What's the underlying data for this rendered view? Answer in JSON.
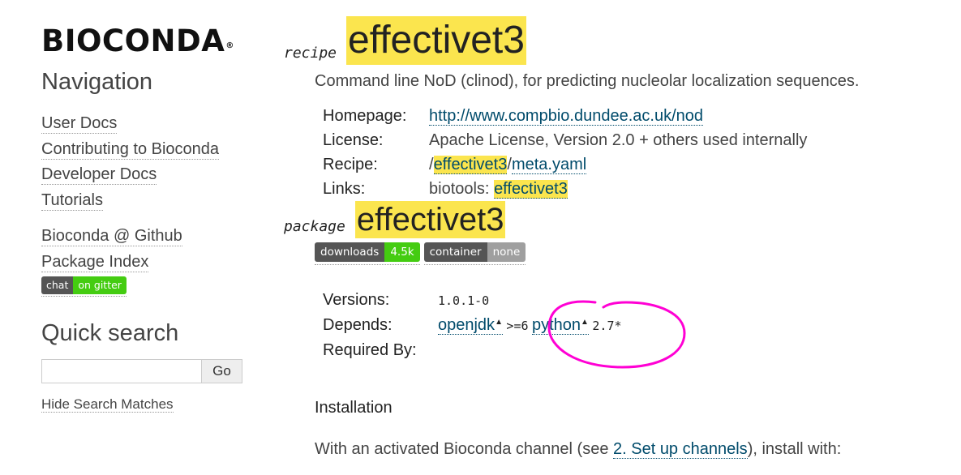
{
  "colors": {
    "highlight": "#fbe54e",
    "link": "#004b6b",
    "badge_dark": "#555555",
    "badge_green": "#4c1",
    "badge_gray": "#9f9f9f",
    "annotation": "#ff00d4"
  },
  "sidebar": {
    "logo": "BIOCONDA",
    "logo_mark": "®",
    "navigation_heading": "Navigation",
    "nav_items": [
      {
        "label": "User Docs"
      },
      {
        "label": "Contributing to Bioconda"
      },
      {
        "label": "Developer Docs"
      },
      {
        "label": "Tutorials"
      }
    ],
    "extra_items": [
      {
        "label": "Bioconda @ Github"
      },
      {
        "label": "Package Index"
      }
    ],
    "gitter_badge": {
      "left": "chat",
      "right": "on gitter"
    },
    "quick_search_heading": "Quick search",
    "search_button": "Go",
    "search_value": "",
    "hide_matches": "Hide Search Matches"
  },
  "recipe": {
    "kind": "recipe",
    "name": "effectivet3",
    "summary": "Command line NoD (clinod), for predicting nucleolar localization sequences.",
    "fields": {
      "homepage_label": "Homepage:",
      "homepage_url": "http://www.compbio.dundee.ac.uk/nod",
      "license_label": "License:",
      "license_value": "Apache License, Version 2.0 + others used internally",
      "recipe_label": "Recipe:",
      "recipe_prefix": "/",
      "recipe_name": "effectivet3",
      "recipe_sep": "/",
      "recipe_file": "meta.yaml",
      "links_label": "Links:",
      "links_prefix": "biotools: ",
      "links_value": "effectivet3"
    }
  },
  "package": {
    "kind": "package",
    "name": "effectivet3",
    "badges": [
      {
        "left": "downloads",
        "right": "4.5k",
        "color": "#4c1"
      },
      {
        "left": "container",
        "right": "none",
        "color": "#9f9f9f"
      }
    ],
    "versions_label": "Versions:",
    "versions_value": "1.0.1-0",
    "depends_label": "Depends:",
    "depends": [
      {
        "name": "openjdk",
        "constraint": ">=6"
      },
      {
        "name": "python",
        "constraint": "2.7*"
      }
    ],
    "required_by_label": "Required By:"
  },
  "installation": {
    "heading": "Installation",
    "text_before": "With an activated Bioconda channel (see ",
    "link": "2. Set up channels",
    "text_after": "), install with:"
  }
}
